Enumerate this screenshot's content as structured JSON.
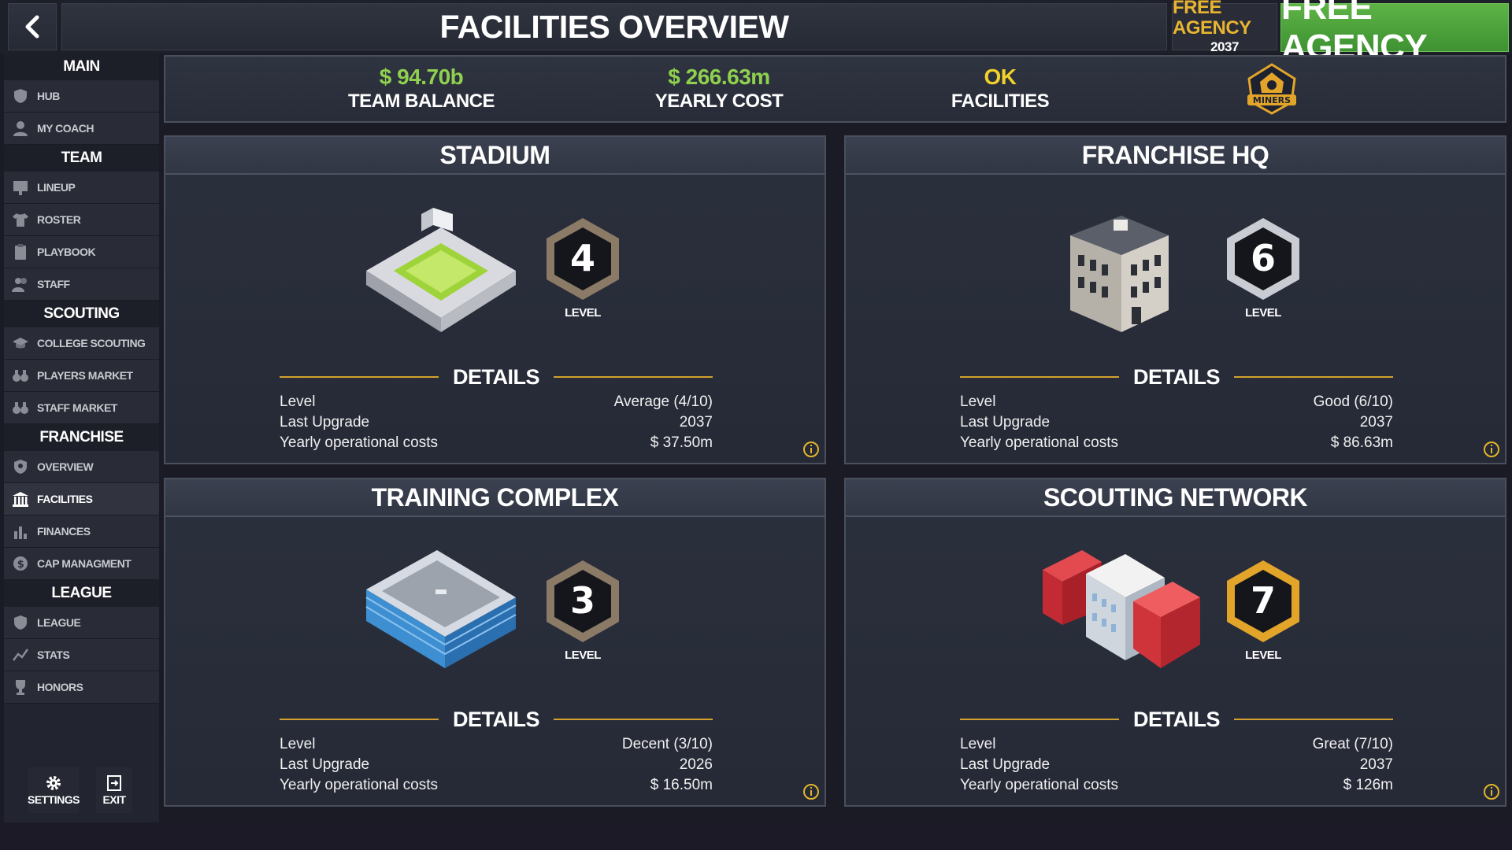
{
  "header": {
    "title": "FACILITIES OVERVIEW",
    "free_agency_label": "FREE AGENCY",
    "free_agency_year": "2037",
    "free_agency_button": "FREE AGENCY"
  },
  "sidebar": {
    "sections": {
      "main": "MAIN",
      "team": "TEAM",
      "scouting": "SCOUTING",
      "franchise": "FRANCHISE",
      "league": "LEAGUE"
    },
    "items": {
      "hub": "HUB",
      "my_coach": "MY COACH",
      "lineup": "LINEUP",
      "roster": "ROSTER",
      "playbook": "PLAYBOOK",
      "staff": "STAFF",
      "college_scouting": "COLLEGE SCOUTING",
      "players_market": "PLAYERS MARKET",
      "staff_market": "STAFF MARKET",
      "overview": "OVERVIEW",
      "facilities": "FACILITIES",
      "finances": "FINANCES",
      "cap_management": "CAP MANAGMENT",
      "league": "LEAGUE",
      "stats": "STATS",
      "honors": "HONORS"
    },
    "active_item": "FACILITIES",
    "settings_label": "SETTINGS",
    "exit_label": "EXIT"
  },
  "stats": {
    "team_balance_value": "$ 94.70b",
    "team_balance_label": "TEAM BALANCE",
    "yearly_cost_value": "$ 266.63m",
    "yearly_cost_label": "YEARLY COST",
    "facilities_value": "OK",
    "facilities_label": "FACILITIES",
    "team_logo_text": "MINERS"
  },
  "details_labels": {
    "title": "DETAILS",
    "level": "Level",
    "last_upgrade": "Last Upgrade",
    "yearly_costs": "Yearly operational costs",
    "level_caption": "LEVEL"
  },
  "facilities": {
    "stadium": {
      "name": "STADIUM",
      "level": "4",
      "level_text": "Average (4/10)",
      "last_upgrade": "2037",
      "yearly_cost": "$ 37.50m",
      "badge_color": "#8a7a66"
    },
    "franchise_hq": {
      "name": "FRANCHISE HQ",
      "level": "6",
      "level_text": "Good (6/10)",
      "last_upgrade": "2037",
      "yearly_cost": "$ 86.63m",
      "badge_color": "#c9ccd2"
    },
    "training_complex": {
      "name": "TRAINING COMPLEX",
      "level": "3",
      "level_text": "Decent (3/10)",
      "last_upgrade": "2026",
      "yearly_cost": "$ 16.50m",
      "badge_color": "#8a7a66"
    },
    "scouting_network": {
      "name": "SCOUTING NETWORK",
      "level": "7",
      "level_text": "Great (7/10)",
      "last_upgrade": "2037",
      "yearly_cost": "$ 126m",
      "badge_color": "#e2a52a"
    }
  },
  "colors": {
    "accent_green": "#8fd14f",
    "accent_yellow": "#f0d22a",
    "gold_line": "#d4a12c",
    "free_agency_green": "#4ea33a"
  }
}
